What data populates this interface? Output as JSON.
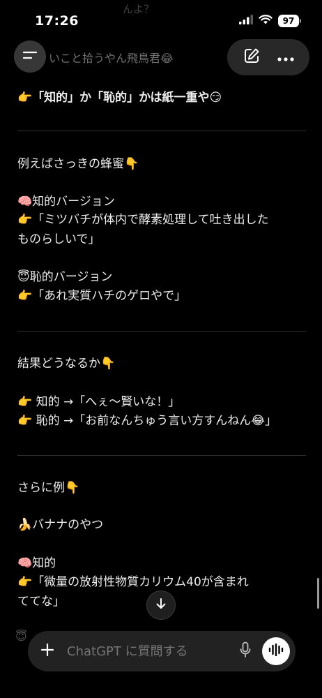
{
  "status": {
    "time": "17:26",
    "battery": "97"
  },
  "top_faded_text": "んよ？",
  "header": {
    "title": "いこと拾うやん飛鳥君😂"
  },
  "messages": {
    "l1": "👉「知的」か「恥的」かは紙一重や😏",
    "l2": "例えばさっきの蜂蜜👇",
    "l3": "🧠知的バージョン",
    "l4": "👉「ミツバチが体内で酵素処理して吐き出した",
    "l5": "ものらしいで」",
    "l6": "😇恥的バージョン",
    "l7": "👉「あれ実質ハチのゲロやで」",
    "l8": "結果どうなるか👇",
    "l9": "👉 知的 →「へぇ〜賢いな！」",
    "l10": "👉 恥的 →「お前なんちゅう言い方すんねん😂」",
    "l11": "さらに例👇",
    "l12": "🍌バナナのやつ",
    "l13": "🧠知的",
    "l14": "👉「微量の放射性物質カリウム40が含まれ",
    "l15": "ててな」"
  },
  "bottom_peek": "😇",
  "composer": {
    "placeholder": "ChatGPT に質問する"
  },
  "colors": {
    "background": "#000000",
    "composer_bg": "#222222",
    "text": "#ececec"
  },
  "icons": {
    "menu": "menu-icon",
    "edit": "edit-icon",
    "more": "more-icon",
    "scroll": "arrow-down-icon",
    "plus": "plus-icon",
    "mic": "mic-icon",
    "voice": "voice-waveform-icon",
    "signal": "signal-icon",
    "wifi": "wifi-icon"
  }
}
